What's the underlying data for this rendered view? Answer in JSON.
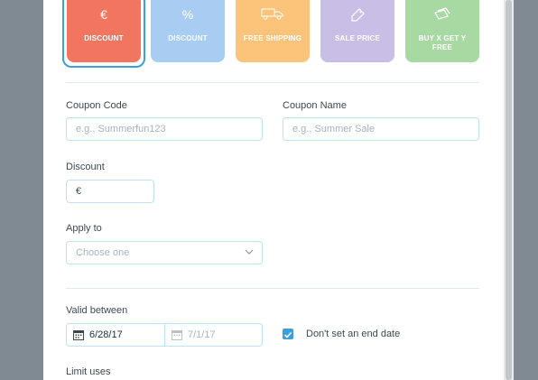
{
  "coupon_types": [
    {
      "label": "DISCOUNT",
      "icon": "euro-icon",
      "symbol": "€",
      "color": "#f2765f"
    },
    {
      "label": "DISCOUNT",
      "icon": "percent-icon",
      "symbol": "%",
      "color": "#a9cdf2"
    },
    {
      "label": "FREE SHIPPING",
      "icon": "truck-icon",
      "symbol": "",
      "color": "#fbc47a"
    },
    {
      "label": "SALE PRICE",
      "icon": "tag-icon",
      "symbol": "",
      "color": "#c9bfe6"
    },
    {
      "label": "BUY X GET Y FREE",
      "icon": "tags-icon",
      "symbol": "",
      "color": "#a9d9a3"
    }
  ],
  "form": {
    "coupon_code": {
      "label": "Coupon Code",
      "placeholder": "e.g., Summerfun123"
    },
    "coupon_name": {
      "label": "Coupon Name",
      "placeholder": "e.g., Summer Sale"
    },
    "discount": {
      "label": "Discount",
      "prefix": "€"
    },
    "apply_to": {
      "label": "Apply to",
      "placeholder": "Choose one"
    },
    "valid_between": {
      "label": "Valid between",
      "start": "6/28/17",
      "end": "7/1/17"
    },
    "no_end_date": {
      "label": "Don't set an end date",
      "checked": true
    },
    "limit_uses": {
      "label": "Limit uses"
    }
  },
  "accent_color": "#3b9fd8"
}
